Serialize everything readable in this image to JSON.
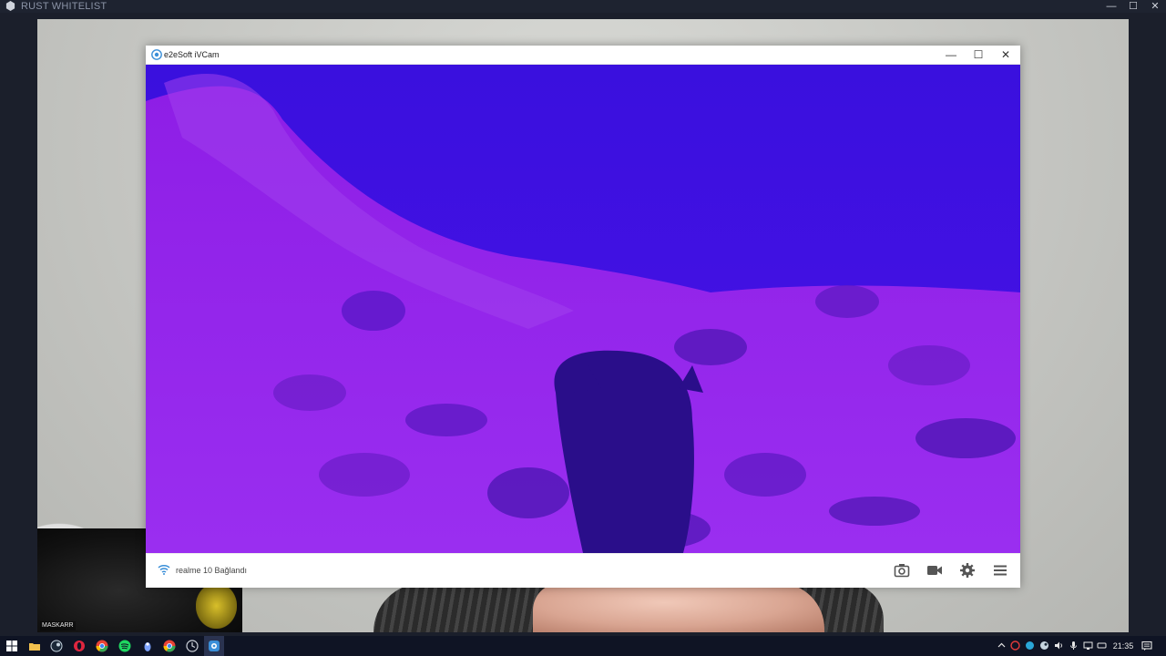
{
  "host_window": {
    "title": "RUST WHITELIST",
    "maximize_glyph": "☐",
    "close_glyph": "✕",
    "minimize_glyph": "—"
  },
  "webcam_background": {
    "mask_label": "MASKARR"
  },
  "ivcam_window": {
    "title": "e2eSoft iVCam",
    "controls": {
      "minimize": "—",
      "maximize": "☐",
      "close": "✕"
    },
    "status": {
      "icon": "wifi-icon",
      "text": "realme 10 Bağlandı"
    },
    "toolbar": [
      {
        "name": "camera-snapshot-button",
        "icon": "camera-icon"
      },
      {
        "name": "record-video-button",
        "icon": "video-camera-icon"
      },
      {
        "name": "settings-button",
        "icon": "gear-icon"
      },
      {
        "name": "menu-button",
        "icon": "hamburger-menu-icon"
      }
    ]
  },
  "taskbar": {
    "start_icon": "windows-start-icon",
    "pinned": [
      "file-explorer-icon",
      "steam-icon",
      "opera-gx-icon",
      "chrome-icon",
      "spotify-icon",
      "app-icon",
      "chrome-icon",
      "clock-app-icon",
      "ivcam-icon"
    ],
    "tray": [
      "chevron-up-icon",
      "app-tray-icon",
      "app-tray-icon",
      "steam-tray-icon",
      "speaker-icon",
      "microphone-icon",
      "network-icon",
      "keyboard-icon"
    ],
    "time": "21:35",
    "notification_icon": "notification-icon"
  },
  "colors": {
    "video_tint": "#4410e6",
    "accent": "#3a8fd8",
    "taskbar": "#0f1424"
  }
}
